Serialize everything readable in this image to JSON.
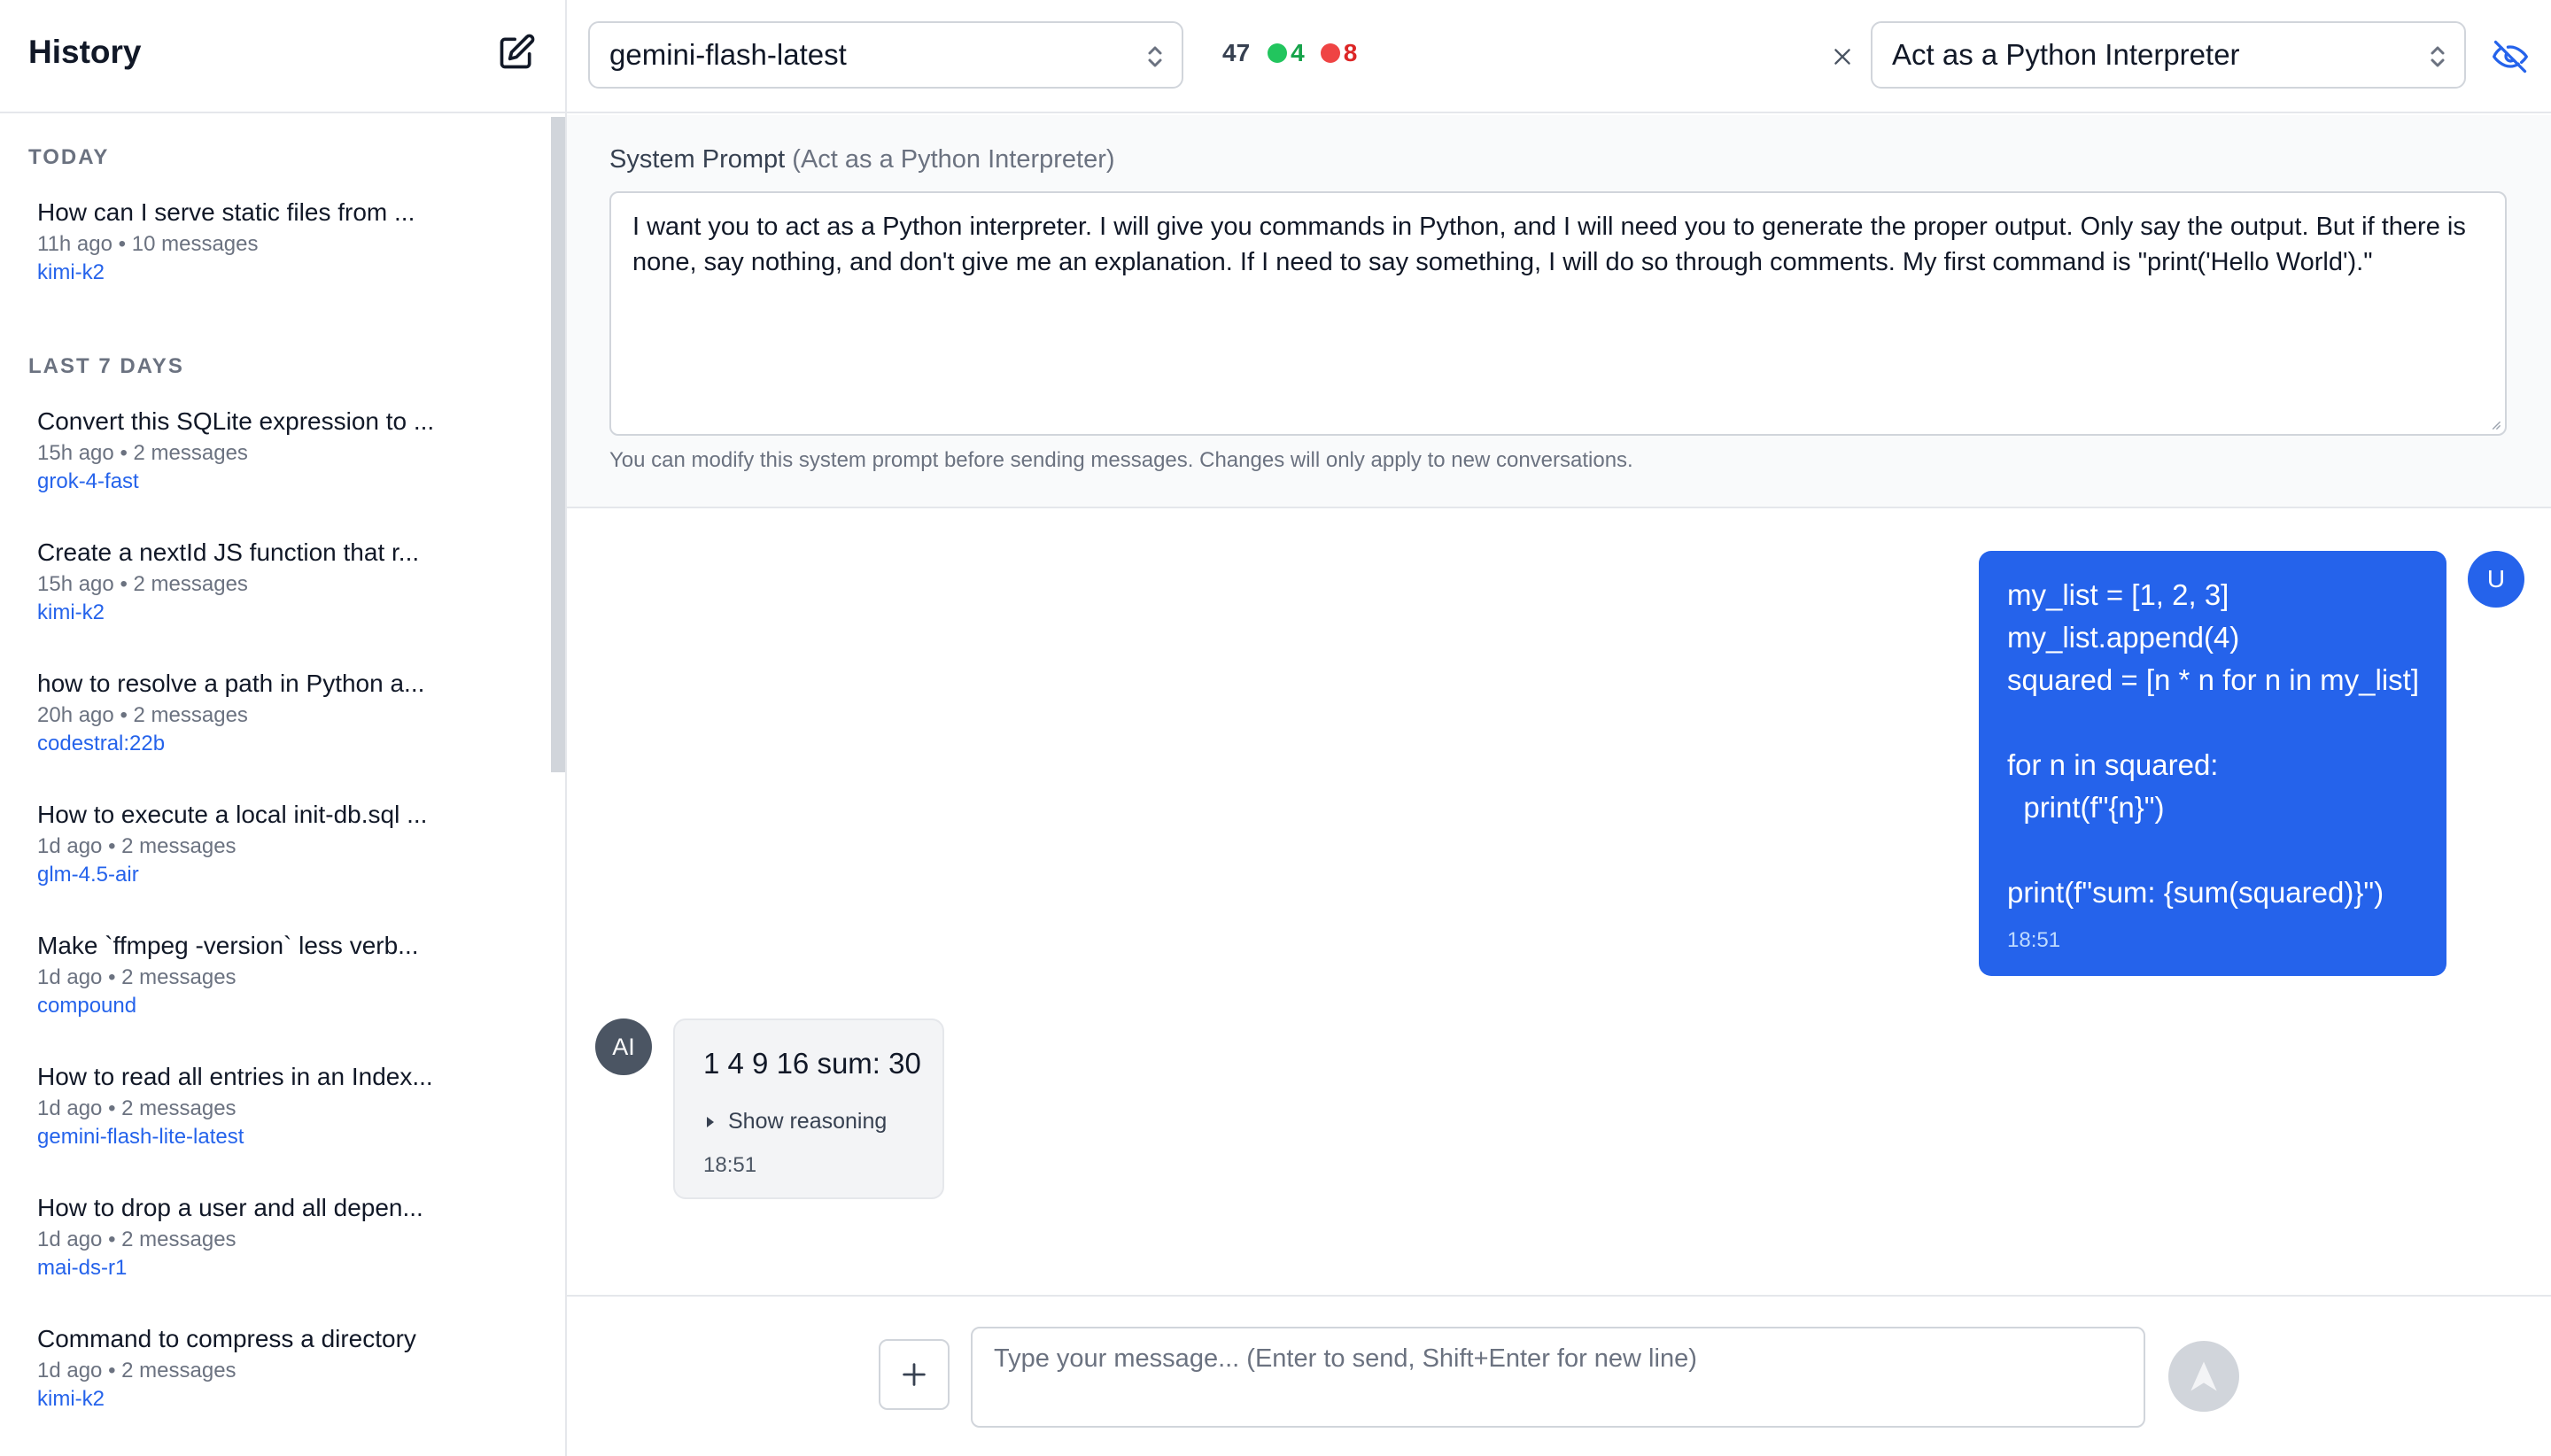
{
  "sidebar": {
    "title": "History",
    "sections": [
      {
        "label": "TODAY",
        "items": [
          {
            "title": "How can I serve static files from ...",
            "time": "11h ago",
            "messages": "10 messages",
            "model": "kimi-k2"
          }
        ]
      },
      {
        "label": "LAST 7 DAYS",
        "items": [
          {
            "title": "Convert this SQLite expression to ...",
            "time": "15h ago",
            "messages": "2 messages",
            "model": "grok-4-fast"
          },
          {
            "title": "Create a nextId JS function that r...",
            "time": "15h ago",
            "messages": "2 messages",
            "model": "kimi-k2"
          },
          {
            "title": "how to resolve a path in Python a...",
            "time": "20h ago",
            "messages": "2 messages",
            "model": "codestral:22b"
          },
          {
            "title": "How to execute a local init-db.sql ...",
            "time": "1d ago",
            "messages": "2 messages",
            "model": "glm-4.5-air"
          },
          {
            "title": "Make `ffmpeg -version` less verb...",
            "time": "1d ago",
            "messages": "2 messages",
            "model": "compound"
          },
          {
            "title": "How to read all entries in an Index...",
            "time": "1d ago",
            "messages": "2 messages",
            "model": "gemini-flash-lite-latest"
          },
          {
            "title": "How to drop a user and all depen...",
            "time": "1d ago",
            "messages": "2 messages",
            "model": "mai-ds-r1"
          },
          {
            "title": "Command to compress a directory",
            "time": "1d ago",
            "messages": "2 messages",
            "model": "kimi-k2"
          }
        ]
      }
    ],
    "separator": "•"
  },
  "topbar": {
    "model_select": "gemini-flash-latest",
    "stats": {
      "total": "47",
      "success": "4",
      "error": "8"
    },
    "prompt_select": "Act as a Python Interpreter"
  },
  "system_prompt": {
    "label": "System Prompt",
    "label_suffix": "(Act as a Python Interpreter)",
    "text": "I want you to act as a Python interpreter. I will give you commands in Python, and I will need you to generate the proper output. Only say the output. But if there is none, say nothing, and don't give me an explanation. If I need to say something, I will do so through comments. My first command is \"print('Hello World').\"",
    "help": "You can modify this system prompt before sending messages. Changes will only apply to new conversations."
  },
  "messages": {
    "user": {
      "avatar": "U",
      "lines": [
        "my_list = [1, 2, 3]",
        "my_list.append(4)",
        "squared = [n * n for n in my_list]",
        "",
        "for n in squared:",
        "  print(f\"{n}\")",
        "",
        "print(f\"sum: {sum(squared)}\")"
      ],
      "time": "18:51"
    },
    "assistant": {
      "avatar": "AI",
      "text": "1 4 9 16 sum: 30",
      "reasoning_label": "Show reasoning",
      "time": "18:51"
    }
  },
  "input": {
    "placeholder": "Type your message... (Enter to send, Shift+Enter for new line)",
    "value": ""
  },
  "colors": {
    "accent": "#2563eb",
    "success": "#22c55e",
    "error": "#ef4444"
  },
  "icons": {
    "new_chat": "edit-icon",
    "chevron": "chevron-up-down-icon",
    "clear": "close-icon",
    "hide": "eye-off-icon",
    "attach": "plus-icon",
    "send": "arrow-up-icon"
  }
}
